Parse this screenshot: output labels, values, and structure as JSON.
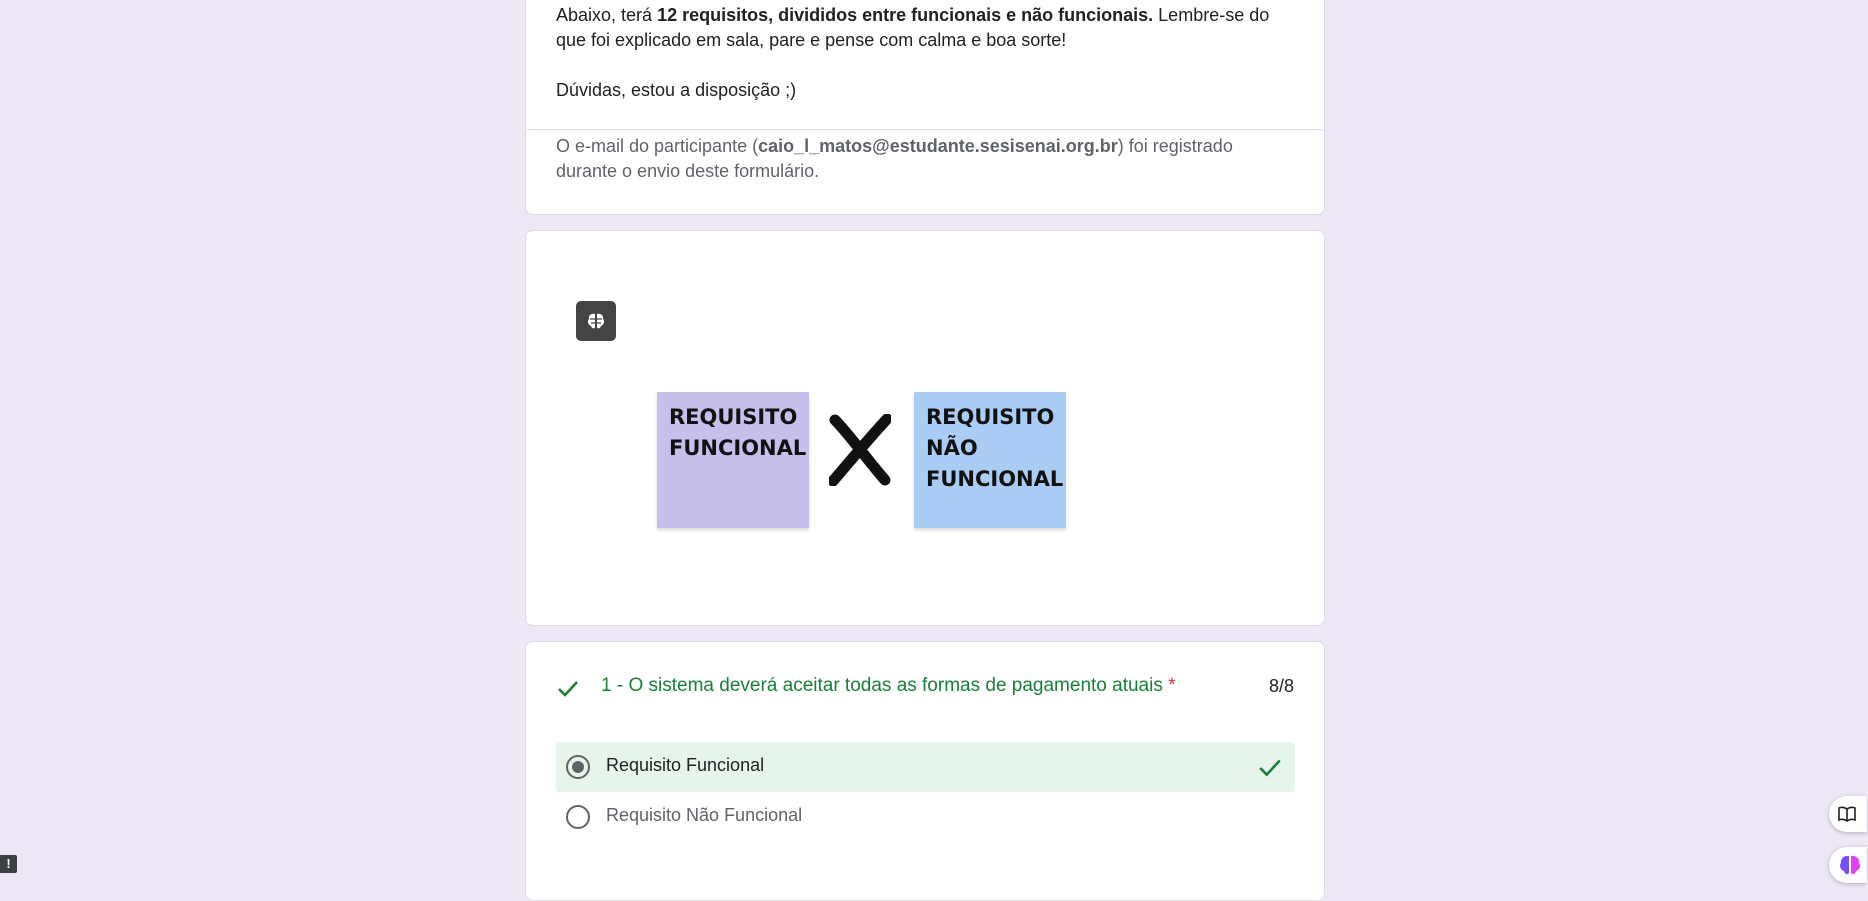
{
  "intro": {
    "text_prefix": "Abaixo, terá ",
    "text_bold": "12 requisitos, divididos entre funcionais e não funcionais.",
    "text_suffix": " Lembre-se do que foi explicado em sala, pare e pense com calma e boa sorte!",
    "doubts": "Dúvidas, estou a disposição ;)",
    "email_prefix": "O e-mail do participante (",
    "email": "caio_l_matos@estudante.sesisenai.org.br",
    "email_suffix": ") foi registrado durante o envio deste formulário."
  },
  "image_card": {
    "note_left": "REQUISITO\nFUNCIONAL",
    "note_right": "REQUISITO\nNÃO\nFUNCIONAL",
    "brain_icon": "brain-icon",
    "x_icon": "x-mark-icon"
  },
  "question": {
    "title": "1 - O sistema deverá aceitar todas as formas de pagamento atuais",
    "required_mark": "*",
    "score": "8/8",
    "options": [
      {
        "label": "Requisito Funcional",
        "selected": true,
        "correct": true
      },
      {
        "label": "Requisito Não Funcional",
        "selected": false
      }
    ]
  },
  "side_buttons": [
    "book-icon",
    "brain-icon"
  ],
  "badge": "!",
  "colors": {
    "background": "#ede7f6",
    "correct_green": "#188038",
    "correct_bg": "#e6f4ea",
    "required_red": "#d93025",
    "note_purple": "#c5c0ec",
    "note_blue": "#a9cdf4"
  }
}
